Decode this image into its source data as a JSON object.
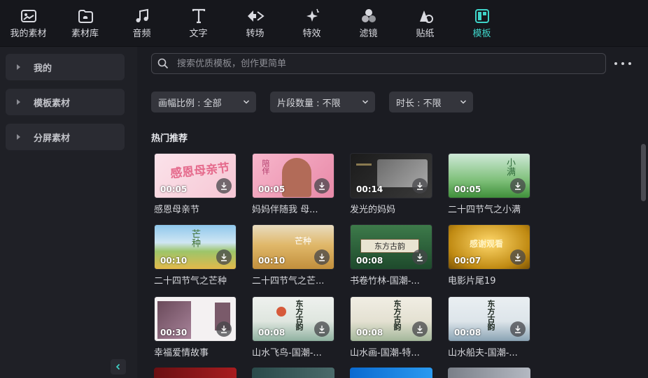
{
  "toolbar": {
    "items": [
      {
        "label": "我的素材",
        "icon": "my-media-icon"
      },
      {
        "label": "素材库",
        "icon": "media-library-icon"
      },
      {
        "label": "音频",
        "icon": "music-note-icon"
      },
      {
        "label": "文字",
        "icon": "text-icon"
      },
      {
        "label": "转场",
        "icon": "transition-icon"
      },
      {
        "label": "特效",
        "icon": "effects-icon"
      },
      {
        "label": "滤镜",
        "icon": "filter-icon"
      },
      {
        "label": "贴纸",
        "icon": "sticker-icon"
      },
      {
        "label": "模板",
        "icon": "template-icon",
        "active": true
      }
    ],
    "active_color": "#3fd4c9"
  },
  "sidebar": {
    "items": [
      {
        "label": "我的"
      },
      {
        "label": "模板素材"
      },
      {
        "label": "分屏素材"
      }
    ]
  },
  "search": {
    "placeholder": "搜索优质模板，创作更简单"
  },
  "filters": [
    {
      "label": "画幅比例 : 全部"
    },
    {
      "label": "片段数量 : 不限"
    },
    {
      "label": "时长 : 不限"
    }
  ],
  "section": {
    "title": "热门推荐"
  },
  "templates": [
    {
      "title": "感恩母亲节",
      "duration": "00:05",
      "thumb_text": "感恩母亲节"
    },
    {
      "title": "妈妈伴随我 母...",
      "duration": "00:05",
      "thumb_text": "陪伴"
    },
    {
      "title": "发光的妈妈",
      "duration": "00:14",
      "thumb_text": ""
    },
    {
      "title": "二十四节气之小满",
      "duration": "00:05",
      "thumb_text": "小满"
    },
    {
      "title": "二十四节气之芒种",
      "duration": "00:10",
      "thumb_text": "芒种"
    },
    {
      "title": "二十四节气之芒...",
      "duration": "00:10",
      "thumb_text": "芒种"
    },
    {
      "title": "书卷竹林-国潮-...",
      "duration": "00:08",
      "thumb_text": "东方古韵"
    },
    {
      "title": "电影片尾19",
      "duration": "00:07",
      "thumb_text": "感谢观看"
    },
    {
      "title": "幸福爱情故事",
      "duration": "00:30",
      "thumb_text": ""
    },
    {
      "title": "山水飞鸟-国潮-...",
      "duration": "00:08",
      "thumb_text": "东方古韵"
    },
    {
      "title": "山水画-国潮-特...",
      "duration": "00:08",
      "thumb_text": "东方古韵"
    },
    {
      "title": "山水船夫-国潮-...",
      "duration": "00:08",
      "thumb_text": "东方古韵"
    }
  ]
}
